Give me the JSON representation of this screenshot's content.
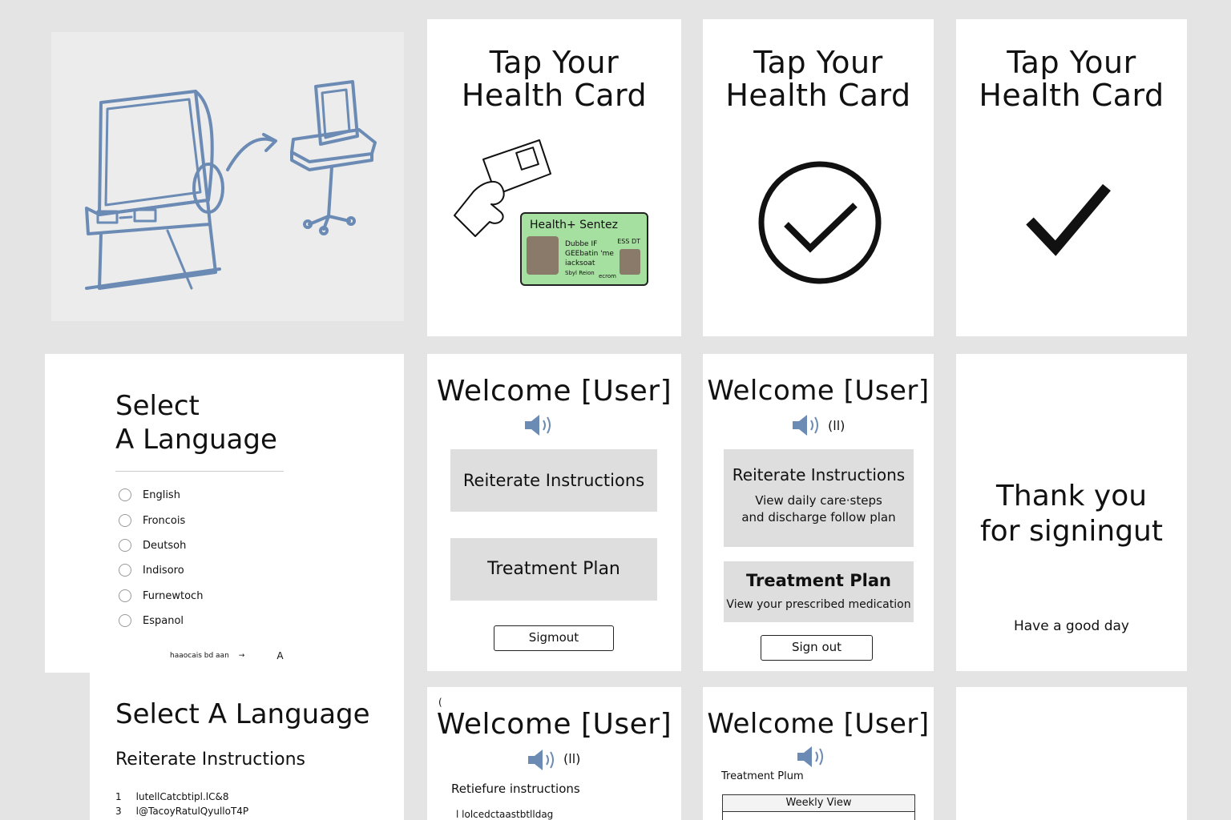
{
  "tap": {
    "title_line1": "Tap Your",
    "title_line2": "Health Card"
  },
  "health_card": {
    "header": "Health+ Sentez",
    "badge": "ESS DT",
    "lines": [
      "Dubbe IF",
      "GEEbatin 'me",
      "iacksoat"
    ],
    "footer_left": "Sbyl Reion",
    "footer_right": "ecrom"
  },
  "language": {
    "title_line1": "Select",
    "title_line2": "A Language",
    "options": [
      "English",
      "Froncois",
      "Deutsoh",
      "Indisoro",
      "Furnewtoch",
      "Espanol"
    ],
    "footer_text": "haaocais bd aan",
    "footer_arrow": "→",
    "footer_letter": "A"
  },
  "welcome": {
    "title": "Welcome [User]",
    "audio_text": "(ll)",
    "reiterate": "Reiterate Instructions",
    "reiterate_sub_1": "View daily care·steps",
    "reiterate_sub_2": "and discharge follow plan",
    "treatment": "Treatment Plan",
    "treatment_sub": "View your prescribed medication",
    "signout_a": "Sigmout",
    "signout_b": "Sign out"
  },
  "thanks": {
    "line1": "Thank you",
    "line2": "for signingut",
    "sub": "Have a good day"
  },
  "bottom": {
    "lang_title": "Select A Language",
    "lang_sub": "Reiterate Instructions",
    "list": [
      {
        "num": "1",
        "text": "lutellCatcbtipl.lC&8"
      },
      {
        "num": "3",
        "text": "l@TacoyRatulQyulloT4P"
      }
    ],
    "welcome_corner": "(",
    "retiefure": "Retiefure instructions",
    "retiefure_line": "l lolcedctaastbtlldag",
    "treatment_plum": "Treatment Plum",
    "weekly_view": "Weekly View"
  },
  "colors": {
    "sketch_blue": "#6b8bb5",
    "card_green": "#a6e0a0",
    "button_gray": "#dedede"
  }
}
